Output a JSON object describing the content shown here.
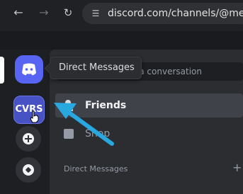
{
  "browser": {
    "url": "discord.com/channels/@me",
    "icons": {
      "back": "back-arrow-icon",
      "forward": "forward-arrow-icon",
      "reload": "reload-icon",
      "site": "site-settings-icon"
    }
  },
  "server_rail": {
    "home_icon": "discord-logo-icon",
    "server_label": "CVRS",
    "add_icon": "plus-icon",
    "explore_icon": "compass-icon"
  },
  "tooltip": {
    "text": "Direct Messages"
  },
  "channel_panel": {
    "search_placeholder": "Find or start a conversation",
    "friends_label": "Friends",
    "shop_label": "Shop",
    "dm_header": "Direct Messages",
    "dm_add": "+"
  },
  "colors": {
    "blurple": "#5865f2",
    "annotation_arrow": "#29a8e0",
    "background": "#1e1f22",
    "panel": "#2b2d31"
  }
}
